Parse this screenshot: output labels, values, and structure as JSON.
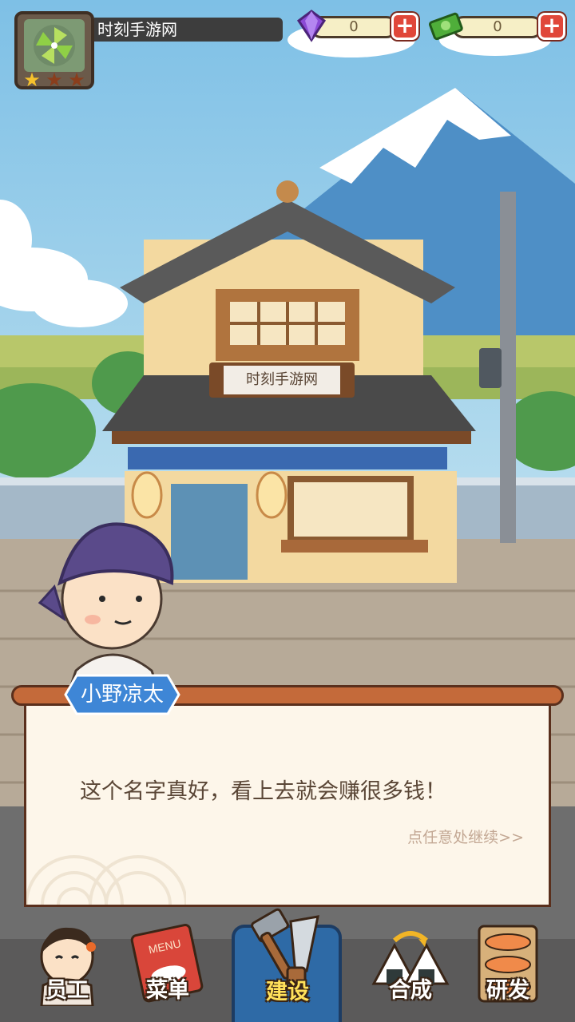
{
  "player": {
    "name": "时刻手游网",
    "stars_filled": 1,
    "stars_total": 3
  },
  "currency": {
    "gems": "0",
    "cash": "0"
  },
  "shop_sign": "时刻手游网",
  "dialog": {
    "speaker": "小野凉太",
    "text": "这个名字真好，看上去就会赚很多钱！",
    "continue_hint": "点任意处继续>>"
  },
  "nav": {
    "staff": "员工",
    "menu": "菜单",
    "build": "建设",
    "merge": "合成",
    "research": "研发",
    "menu_book_text": "MENU"
  },
  "colors": {
    "sky": "#87c6e6",
    "accent_blue": "#2e6aa6",
    "rail": "#c46a3a",
    "plus": "#e0473a"
  }
}
